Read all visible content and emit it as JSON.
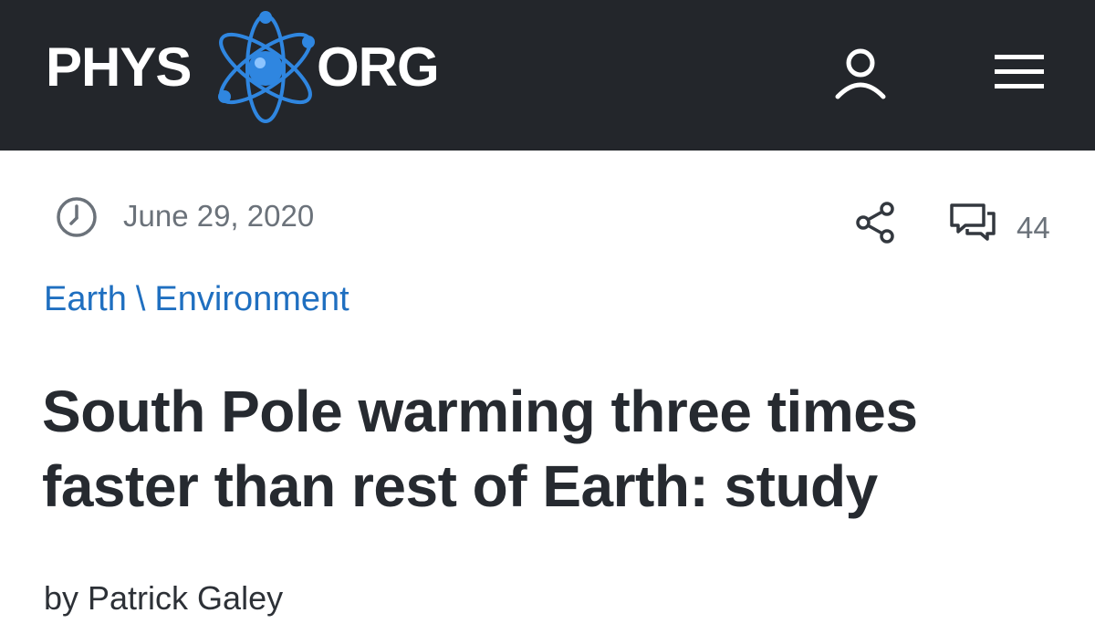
{
  "header": {
    "logo_left": "PHYS",
    "logo_right": "ORG",
    "logo_icon": "atom-icon",
    "user_icon": "user-icon",
    "menu_icon": "hamburger-menu-icon",
    "background_color": "#23262b",
    "logo_accent_color": "#2f86e0"
  },
  "article": {
    "date": "June 29, 2020",
    "share_icon": "share-icon",
    "comment_icon": "comment-icon",
    "comment_count": "44",
    "breadcrumb": {
      "category": "Earth",
      "separator": "\\",
      "subcategory": "Environment"
    },
    "title": "South Pole warming three times faster than rest of Earth: study",
    "byline": "by Patrick Galey",
    "link_color": "#1f6fc0"
  }
}
